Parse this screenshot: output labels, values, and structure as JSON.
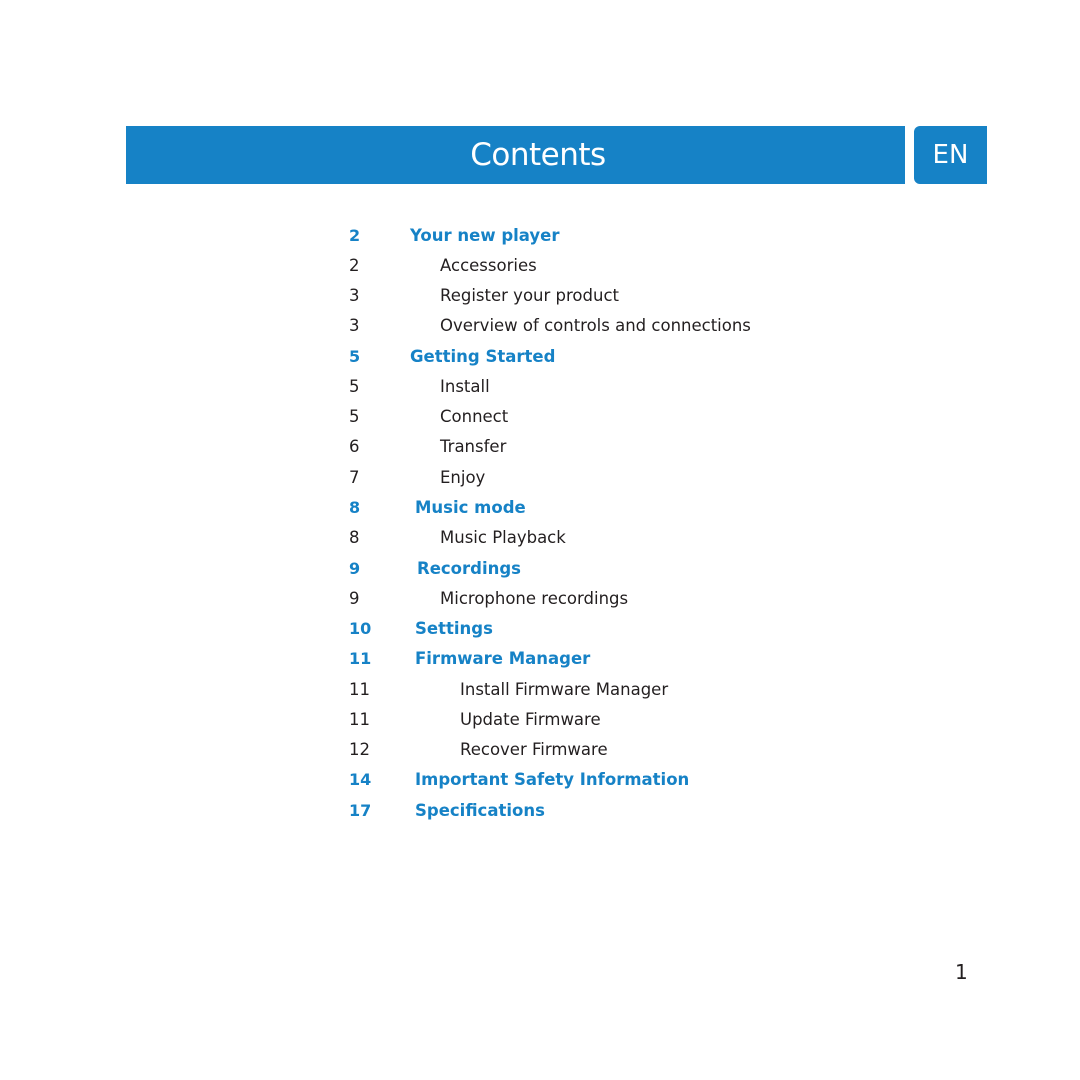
{
  "header": {
    "title": "Contents",
    "language_tab": "EN"
  },
  "toc": [
    {
      "page": "2",
      "title": "Your new player",
      "level": "section"
    },
    {
      "page": "2",
      "title": "Accessories",
      "level": "sub"
    },
    {
      "page": "3",
      "title": "Register your product",
      "level": "sub"
    },
    {
      "page": "3",
      "title": "Overview of controls and connections",
      "level": "sub"
    },
    {
      "page": "5",
      "title": "Getting Started",
      "level": "section"
    },
    {
      "page": "5",
      "title": "Install",
      "level": "sub"
    },
    {
      "page": "5",
      "title": "Connect",
      "level": "sub"
    },
    {
      "page": "6",
      "title": "Transfer",
      "level": "sub"
    },
    {
      "page": "7",
      "title": "Enjoy",
      "level": "sub"
    },
    {
      "page": "8",
      "title": "Music mode",
      "level": "section"
    },
    {
      "page": "8",
      "title": "Music Playback",
      "level": "sub"
    },
    {
      "page": "9",
      "title": "Recordings",
      "level": "section"
    },
    {
      "page": "9",
      "title": "Microphone recordings",
      "level": "sub"
    },
    {
      "page": "10",
      "title": "Settings",
      "level": "section"
    },
    {
      "page": "11",
      "title": "Firmware Manager",
      "level": "section"
    },
    {
      "page": "11",
      "title": "Install Firmware Manager",
      "level": "sub"
    },
    {
      "page": "11",
      "title": "Update Firmware",
      "level": "sub"
    },
    {
      "page": "12",
      "title": "Recover Firmware",
      "level": "sub"
    },
    {
      "page": "14",
      "title": "Important Safety Information",
      "level": "section"
    },
    {
      "page": "17",
      "title": "Specifications",
      "level": "section"
    }
  ],
  "footer": {
    "page_number": "1"
  },
  "colors": {
    "accent": "#1682c6",
    "text": "#231f20"
  }
}
